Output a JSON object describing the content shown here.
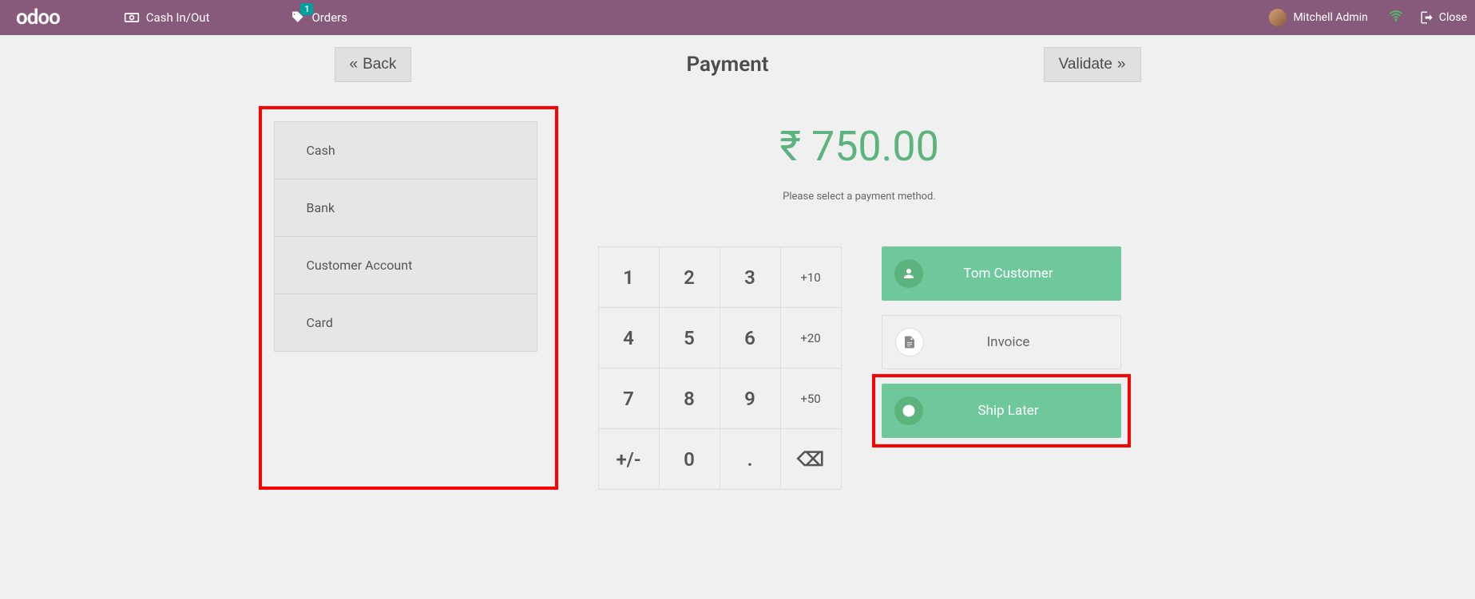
{
  "nav": {
    "logo_text": "odoo",
    "cash_label": "Cash In/Out",
    "orders_label": "Orders",
    "orders_badge": "1",
    "user_name": "Mitchell Admin",
    "close_label": "Close"
  },
  "header": {
    "back_label": "Back",
    "title": "Payment",
    "validate_label": "Validate"
  },
  "payment_methods": [
    "Cash",
    "Bank",
    "Customer Account",
    "Card"
  ],
  "amount_display": "₹ 750.00",
  "select_message": "Please select a payment method.",
  "numpad": {
    "r0": [
      "1",
      "2",
      "3",
      "+10"
    ],
    "r1": [
      "4",
      "5",
      "6",
      "+20"
    ],
    "r2": [
      "7",
      "8",
      "9",
      "+50"
    ],
    "r3": [
      "+/-",
      "0",
      ".",
      "⌫"
    ]
  },
  "actions": {
    "customer_label": "Tom Customer",
    "invoice_label": "Invoice",
    "ship_later_label": "Ship Later"
  }
}
